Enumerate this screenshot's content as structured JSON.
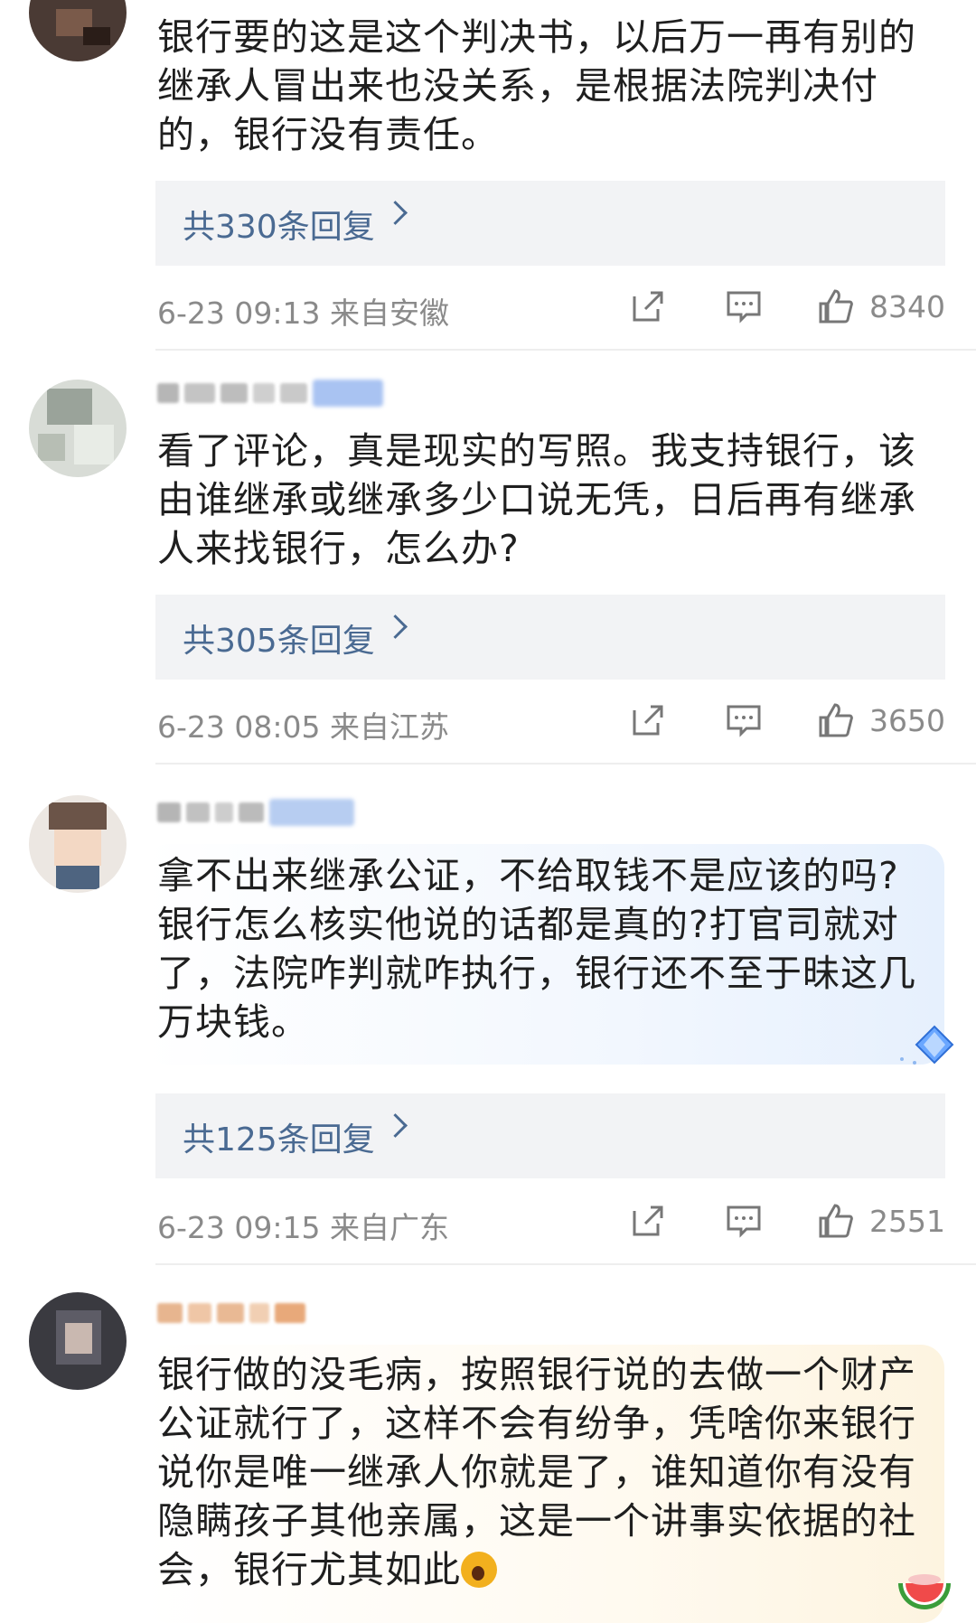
{
  "comments": [
    {
      "text": "银行要的这是这个判决书，以后万一再有别的继承人冒出来也没关系，是根据法院判决付的，银行没有责任。",
      "replies": "共330条回复",
      "time": "6-23 09:13",
      "location": "来自安徽",
      "likes": "8340"
    },
    {
      "text": "看了评论，真是现实的写照。我支持银行，该由谁继承或继承多少口说无凭，日后再有继承人来找银行，怎么办?",
      "replies": "共305条回复",
      "time": "6-23 08:05",
      "location": "来自江苏",
      "likes": "3650"
    },
    {
      "text": "拿不出来继承公证，不给取钱不是应该的吗?银行怎么核实他说的话都是真的?打官司就对了，法院咋判就咋执行，银行还不至于昧这几万块钱。",
      "replies": "共125条回复",
      "time": "6-23 09:15",
      "location": "来自广东",
      "likes": "2551"
    },
    {
      "text": "银行做的没毛病，按照银行说的去做一个财产公证就行了，这样不会有纷争，凭啥你来银行说你是唯一继承人你就是了，谁知道你有没有隐瞒孩子其他亲属，这是一个讲事实依据的社会，银行尤其如此"
    }
  ],
  "icons": [
    "share-icon",
    "comment-icon",
    "thumbs-up-icon"
  ],
  "colors": {
    "reply_link": "#4a6a92",
    "reply_bg": "#f2f3f5",
    "meta_text": "#8a8a8a"
  }
}
